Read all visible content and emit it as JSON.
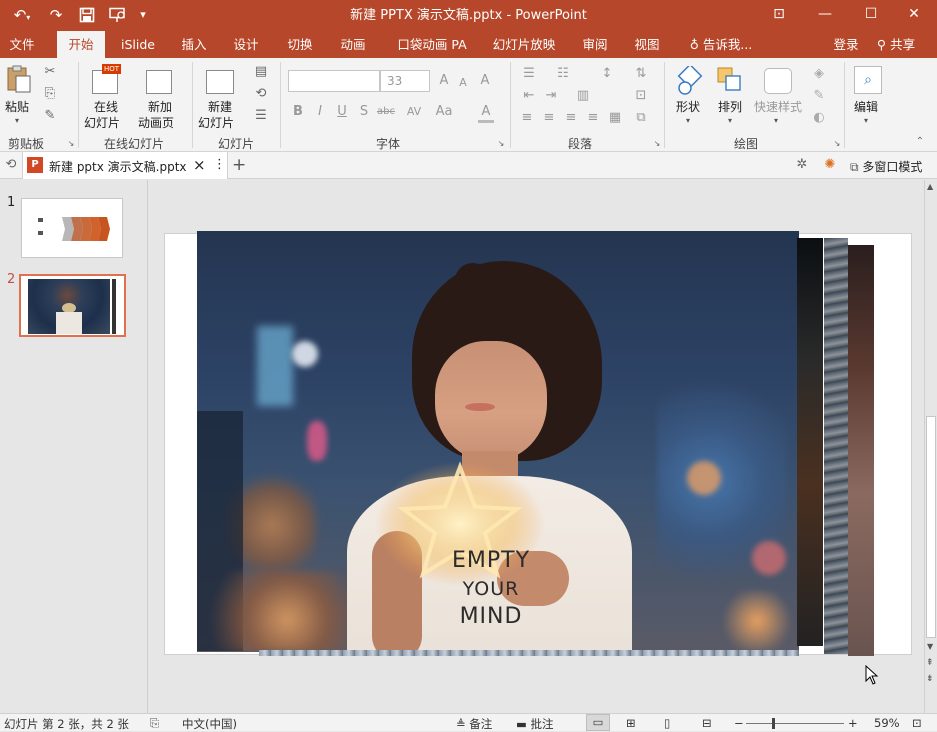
{
  "window": {
    "title": "新建 PPTX 演示文稿.pptx - PowerPoint",
    "colors": {
      "accent": "#b7472a",
      "ribbon_bg": "#f3f3f3",
      "canvas_bg": "#e6e6e6"
    }
  },
  "quick_access": {
    "undo_icon": "↶",
    "redo_icon": "↷",
    "save_icon": "save-icon",
    "present_icon": "present-from-start-icon",
    "more_icon": "▾"
  },
  "window_buttons": {
    "ribbon_display_icon": "⊡",
    "minimize_icon": "—",
    "maximize_icon": "☐",
    "close_icon": "✕"
  },
  "menu": {
    "tabs": [
      "文件",
      "开始",
      "iSlide",
      "插入",
      "设计",
      "切换",
      "动画",
      "口袋动画 PA",
      "幻灯片放映",
      "审阅",
      "视图"
    ],
    "active_tab": "开始",
    "tell_me": "告诉我...",
    "sign_in": "登录",
    "share": "共享"
  },
  "ribbon": {
    "clipboard": {
      "paste": "粘贴",
      "group": "剪贴板"
    },
    "online_slides": {
      "online": "在线",
      "online2": "幻灯片",
      "new_anim": "新加",
      "new_anim2": "动画页",
      "hot_badge": "HOT",
      "group": "在线幻灯片"
    },
    "slides": {
      "new": "新建",
      "new2": "幻灯片",
      "group": "幻灯片"
    },
    "font": {
      "font_name": "",
      "font_size": "33",
      "grow": "A",
      "shrink": "A",
      "clear": "A",
      "bold": "B",
      "italic": "I",
      "underline": "U",
      "shadow": "S",
      "strike": "abc",
      "spacing": "AV",
      "case": "Aa",
      "color": "A",
      "group": "字体"
    },
    "paragraph": {
      "group": "段落"
    },
    "drawing": {
      "shape": "形状",
      "arrange": "排列",
      "quick_style": "快速样式",
      "group": "绘图"
    },
    "editing": {
      "label": "编辑"
    }
  },
  "doc_tabs": {
    "tab_label": "新建 pptx 演示文稿.pptx",
    "close": "×",
    "more": "⋮",
    "add": "+",
    "multi_window": "多窗口模式"
  },
  "thumbnails": [
    {
      "number": "1",
      "selected": false
    },
    {
      "number": "2",
      "selected": true
    }
  ],
  "slide": {
    "shirt_text": [
      "EMPTY",
      "YOUR",
      "MIND"
    ]
  },
  "statusbar": {
    "slide_info": "幻灯片 第 2 张，共 2 张",
    "language": "中文(中国)",
    "notes": "备注",
    "comments": "批注",
    "zoom_minus": "−",
    "zoom_plus": "+",
    "zoom_percent": "59%",
    "zoom_level": 0.59
  }
}
